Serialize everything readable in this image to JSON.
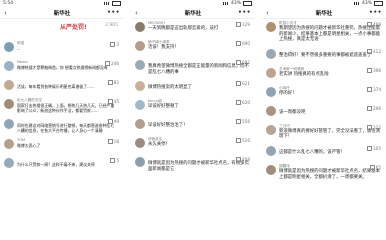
{
  "panels": [
    {
      "status": {
        "time": "5:54",
        "battery": ""
      },
      "title": "新华社",
      "header_text": "从严处罚!",
      "header_count": "2,965",
      "comments": [
        {
          "name": "阿诺",
          "like": "3",
          "text": "...",
          "color": "#7a9fb5"
        },
        {
          "name": "Nemo",
          "like": "246",
          "text": "微博热搜才是罪魁祸首，你 想看点热搜榜新闻都没有",
          "color": "#9bb0c6"
        },
        {
          "name": "",
          "like": "82",
          "text": "活该，每年看到各种娱乐明星也离谱极了……",
          "color": "#c0a892"
        },
        {
          "name": "乱七八糟的天空",
          "like": "45",
          "text": "国家打击热搜很正确，上面，想热几天热几天，已经严重影响了公众，新浪这种炒作手法，都要罚款……",
          "color": "#a38b76"
        },
        {
          "name": "",
          "like": "49",
          "text": "同时也建议对网络营销号进行整顿，每天都营造各种乱七八糟的信息，在各大平台传播，让人身心一个清静",
          "color": "#8fa6b8"
        },
        {
          "name": "TOM",
          "like": "18",
          "text": "微博太恶心了",
          "color": "#b4a08a"
        },
        {
          "name": "",
          "like": "5",
          "text": "为什么只罚款一周？这样不痛不痒，建议关停",
          "color": "#96a9bd"
        }
      ]
    },
    {
      "status": {
        "time": "",
        "battery": "43%"
      },
      "title": "新华社",
      "header_text": "",
      "header_count": "",
      "comments": [
        {
          "name": "MEOWVH",
          "like": "129",
          "text": "一天到晚都是这出轨那恋爱的，该打",
          "color": "#8a7a6a"
        },
        {
          "name": "柳子绿小绿茶",
          "like": "690",
          "text": "活该！我支持！",
          "color": "#b59c86"
        },
        {
          "name": "",
          "like": "692",
          "text": "我真希望微博热搜全都是正能量的新闻和信息，而不是乱七八糟的事",
          "color": "#9caab8"
        },
        {
          "name": "",
          "like": "621",
          "text": "微博热搜卖的太明显了",
          "color": "#c8b196"
        },
        {
          "name": "Jenny颖",
          "like": "620",
          "text": "早该好好整顿了",
          "color": "#a0b8c9"
        },
        {
          "name": "",
          "like": "556",
          "text": "早该好好整治治了！",
          "color": "#b39f8c"
        },
        {
          "name": "伊我余生",
          "like": "516",
          "text": "永久关停！",
          "color": "#9c8a7d"
        },
        {
          "name": "",
          "like": "408",
          "text": "微博就是因为热搜的问题才被新华社点名，有很多负面新闻都是它",
          "color": "#8ba0ac"
        }
      ]
    },
    {
      "status": {
        "time": "",
        "battery": "43%"
      },
      "title": "新华社",
      "header_text": "",
      "header_count": "",
      "comments": [
        {
          "name": "机智小天才",
          "like": "488",
          "text": "我期望因为热搜的问题才被新华社重罚，热搜正能量的新闻少，结果基本上都是明星相关，一点小事都能上热搜，真是太无语",
          "color": "#b09070"
        },
        {
          "name": "",
          "like": "412",
          "text": "整治得好！要不然很多重要的事都被遮遮盖盖了",
          "color": "#9aa8b4"
        },
        {
          "name": "艺术家一网清扬",
          "like": "396",
          "text": "老实讲 热搜真的有点乱啦",
          "color": "#c0a38e"
        },
        {
          "name": "小鸡仔",
          "like": "374",
          "text": "停的好！",
          "color": "#8fa3b6"
        },
        {
          "name": "",
          "like": "296",
          "text": "该一周都没吧",
          "color": "#a99480"
        },
        {
          "name": "三分巧",
          "like": "222",
          "text": "新浪微博真的要好好管管了，完全没法看了，该宣清理下！",
          "color": "#b5a497"
        },
        {
          "name": "",
          "like": "105",
          "text": "这都是什么乱七八糟的，该严管！",
          "color": "#95a4b0"
        },
        {
          "name": "邵鹏伟",
          "like": "65",
          "text": "微博就是因为热搜的问题才被新华社点名，结果基本上都是明星相关，全都扒清了，一周都要关。",
          "color": "#a08e7c"
        }
      ]
    }
  ]
}
